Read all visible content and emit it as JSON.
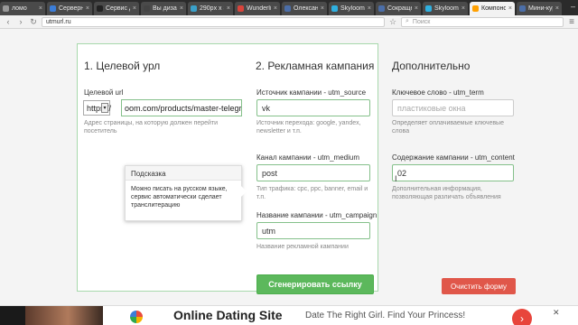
{
  "browser": {
    "tabs": [
      {
        "label": "ломо",
        "color": "#999999"
      },
      {
        "label": "Серверный",
        "color": "#3b7dd8"
      },
      {
        "label": "Сервис д",
        "color": "#222222"
      },
      {
        "label": "Вы дизай",
        "color": "#444444"
      },
      {
        "label": "290px x 33",
        "color": "#3aa0c9"
      },
      {
        "label": "Wunderlist",
        "color": "#d9443b"
      },
      {
        "label": "Олександ",
        "color": "#4b6ea8"
      },
      {
        "label": "Skyloom",
        "color": "#2fb0e0"
      },
      {
        "label": "Сокращен",
        "color": "#4b6ea8"
      },
      {
        "label": "Skyloom - д",
        "color": "#2fb0e0"
      },
      {
        "label": "Компонов",
        "color": "#ffa000"
      },
      {
        "label": "Мини-кур",
        "color": "#4b6ea8"
      }
    ],
    "active_tab_index": 10,
    "url": "utmurl.ru",
    "search_placeholder": "Поиск"
  },
  "form": {
    "col1_title": "1. Целевой урл",
    "col2_title": "2. Рекламная кампания",
    "col3_title": "Дополнительно",
    "target_url": {
      "label": "Целевой url",
      "protocol": "https://",
      "value": "oom.com/products/master-telegram",
      "hint": "Адрес страницы, на которую должен перейти посетитель"
    },
    "utm_source": {
      "label": "Источник кампании - utm_source",
      "value": "vk",
      "hint": "Источник перехода: google, yandex, newsletter и т.п."
    },
    "utm_medium": {
      "label": "Канал кампании - utm_medium",
      "value": "post",
      "hint": "Тип трафика: cpc, ppc, banner, email и т.п."
    },
    "utm_campaign": {
      "label": "Название кампании - utm_campaign",
      "value": "utm",
      "hint": "Название рекламной кампании"
    },
    "utm_term": {
      "label": "Ключевое слово - utm_term",
      "placeholder": "пластиковые окна",
      "hint": "Определяет оплачиваемые ключевые слова"
    },
    "utm_content": {
      "label": "Содержание кампании - utm_content",
      "value": "02",
      "hint": "Дополнительная информация, позволяющая различать объявления"
    },
    "tooltip": {
      "title": "Подсказка",
      "body": "Можно писать на русском языке, сервис автоматически сделает транслитерацию"
    },
    "generate_button": "Сгенерировать ссылку",
    "clear_button": "Очистить форму"
  },
  "ad": {
    "title": "Online Dating Site",
    "text": "Date The Right Girl. Find Your Princess!"
  },
  "colors": {
    "accent_green": "#5cb85c",
    "clear_red": "#e0574a",
    "field_border": "#84c08a"
  }
}
